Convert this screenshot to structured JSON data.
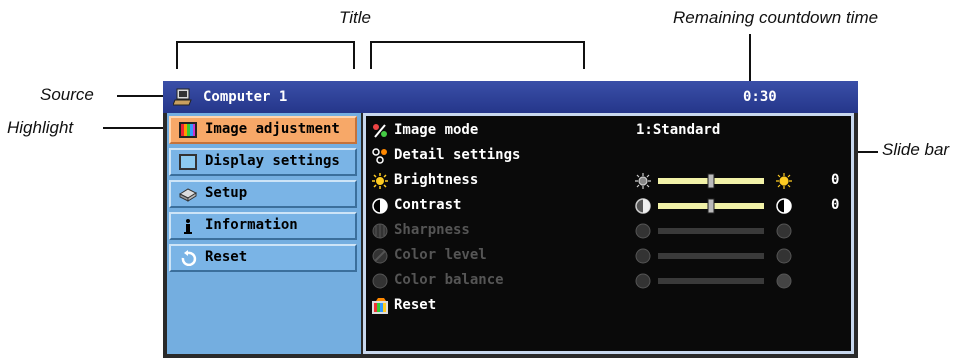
{
  "callouts": {
    "title": "Title",
    "remaining": "Remaining countdown time",
    "source": "Source",
    "highlight": "Highlight",
    "slide_bar": "Slide bar"
  },
  "titlebar": {
    "source_name": "Computer 1",
    "timer": "0:30"
  },
  "tabs": [
    {
      "label": "Image adjustment",
      "icon": "image-adjustment-icon",
      "active": true
    },
    {
      "label": "Display settings",
      "icon": "display-settings-icon",
      "active": false
    },
    {
      "label": "Setup",
      "icon": "setup-icon",
      "active": false
    },
    {
      "label": "Information",
      "icon": "information-icon",
      "active": false
    },
    {
      "label": "Reset",
      "icon": "reset-icon",
      "active": false
    }
  ],
  "rows": [
    {
      "label": "Image mode",
      "value": "1:Standard",
      "icon": "image-mode-icon"
    },
    {
      "label": "Detail settings",
      "icon": "detail-settings-icon"
    },
    {
      "label": "Brightness",
      "number": "0",
      "level": 0.5,
      "icon": "brightness-icon"
    },
    {
      "label": "Contrast",
      "number": "0",
      "level": 0.5,
      "icon": "contrast-icon"
    },
    {
      "label": "Sharpness",
      "icon": "sharpness-icon",
      "disabled": true
    },
    {
      "label": "Color level",
      "icon": "color-level-icon",
      "disabled": true
    },
    {
      "label": "Color balance",
      "icon": "color-balance-icon",
      "disabled": true
    },
    {
      "label": "Reset",
      "icon": "reset-icon"
    }
  ],
  "colors": {
    "titlebar": "#2e3f98",
    "sidebar": "#74aee0",
    "highlight": "#f7a868",
    "panel": "#0a0a0a"
  }
}
